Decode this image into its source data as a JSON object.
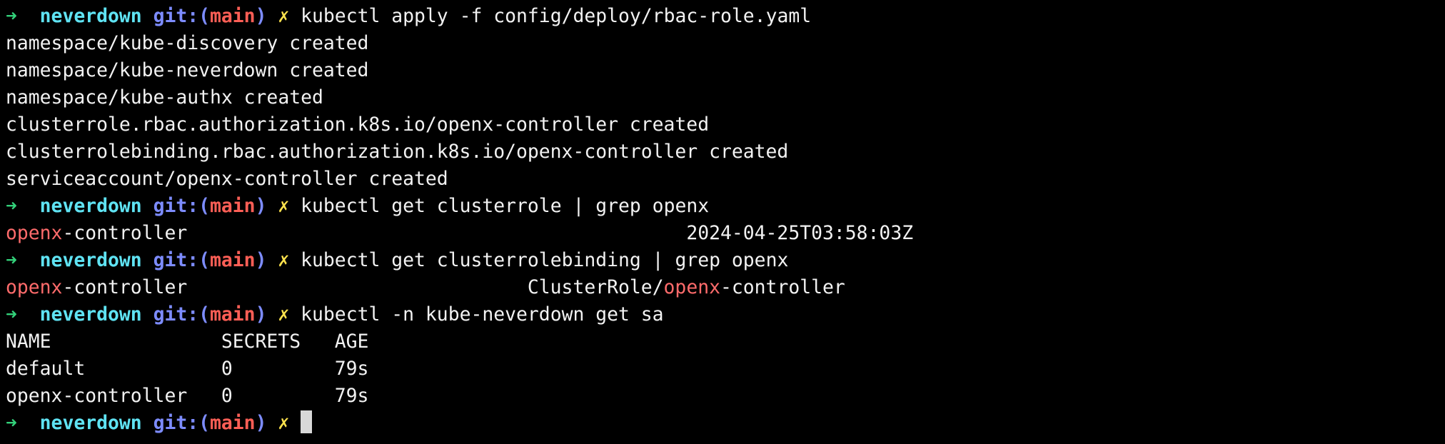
{
  "prompt": {
    "arrow": "➜",
    "dir": "neverdown",
    "git_prefix": "git:(",
    "branch": "main",
    "git_suffix": ")",
    "dirty": "✗"
  },
  "lines": [
    {
      "type": "prompt",
      "cmd": "kubectl apply -f config/deploy/rbac-role.yaml"
    },
    {
      "type": "out",
      "text": "namespace/kube-discovery created"
    },
    {
      "type": "out",
      "text": "namespace/kube-neverdown created"
    },
    {
      "type": "out",
      "text": "namespace/kube-authx created"
    },
    {
      "type": "out",
      "text": "clusterrole.rbac.authorization.k8s.io/openx-controller created"
    },
    {
      "type": "out",
      "text": "clusterrolebinding.rbac.authorization.k8s.io/openx-controller created"
    },
    {
      "type": "out",
      "text": "serviceaccount/openx-controller created"
    },
    {
      "type": "prompt",
      "cmd": "kubectl get clusterrole | grep openx"
    },
    {
      "type": "match",
      "segments": [
        {
          "t": "openx",
          "m": true
        },
        {
          "t": "-controller                                            2024-04-25T03:58:03Z",
          "m": false
        }
      ]
    },
    {
      "type": "prompt",
      "cmd": "kubectl get clusterrolebinding | grep openx"
    },
    {
      "type": "match",
      "segments": [
        {
          "t": "openx",
          "m": true
        },
        {
          "t": "-controller                              ClusterRole/",
          "m": false
        },
        {
          "t": "openx",
          "m": true
        },
        {
          "t": "-controller",
          "m": false
        }
      ]
    },
    {
      "type": "prompt",
      "cmd": "kubectl -n kube-neverdown get sa"
    },
    {
      "type": "out",
      "text": "NAME               SECRETS   AGE"
    },
    {
      "type": "out",
      "text": "default            0         79s"
    },
    {
      "type": "out",
      "text": "openx-controller   0         79s"
    },
    {
      "type": "prompt",
      "cmd": "",
      "cursor": true
    }
  ]
}
